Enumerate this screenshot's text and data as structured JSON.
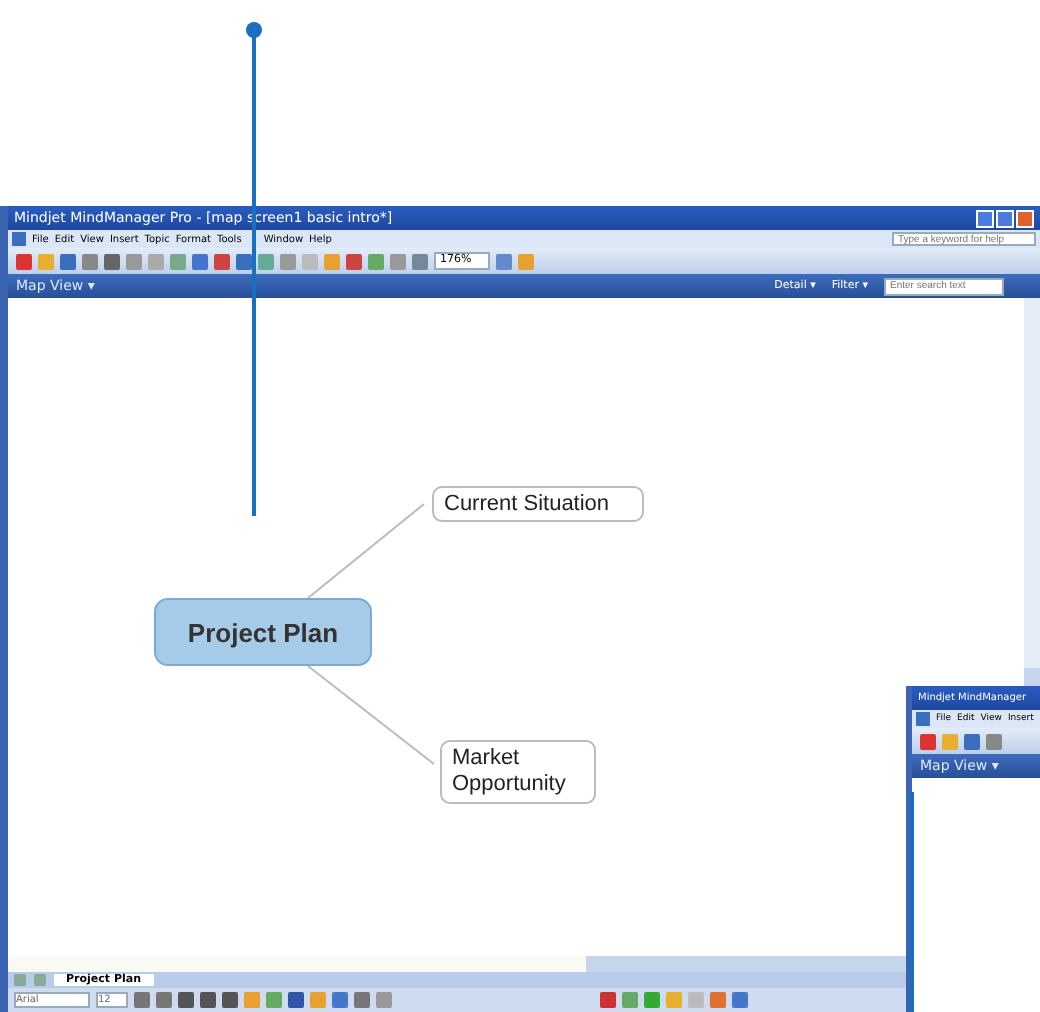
{
  "window": {
    "title": "Mindjet MindManager Pro - [map screen1 basic intro*]"
  },
  "menu": [
    "File",
    "Edit",
    "View",
    "Insert",
    "Topic",
    "Format",
    "Tools",
    "Window",
    "Help"
  ],
  "help_search": {
    "placeholder": "Type a keyword for help"
  },
  "toolbar": {
    "zoom": "176%"
  },
  "map_view_bar": {
    "title": "Map View ▾",
    "detail": "Detail ▾",
    "filter": "Filter ▾",
    "search": {
      "placeholder": "Enter search text"
    }
  },
  "map": {
    "central": "Project Plan",
    "topics": [
      {
        "label": "Current Situation"
      },
      {
        "label": "Market Opportunity"
      }
    ]
  },
  "sheet_tabs": [
    {
      "label": "Project Plan",
      "selected": true
    }
  ],
  "format_bar": {
    "font": "Arial",
    "size": "12"
  },
  "second_window": {
    "title": "Mindjet MindManager",
    "menu": [
      "File",
      "Edit",
      "View",
      "Insert"
    ],
    "map_view": "Map View ▾"
  }
}
